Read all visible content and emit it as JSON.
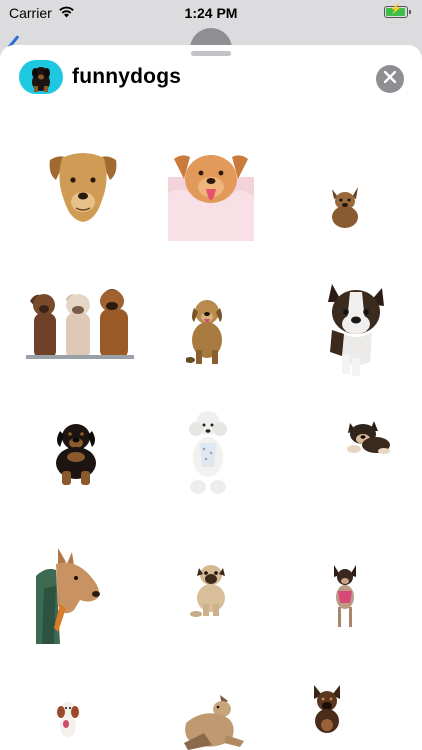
{
  "status_bar": {
    "carrier": "Carrier",
    "time": "1:24 PM",
    "battery_level": 0.85
  },
  "header": {
    "app_name": "funnydogs",
    "app_icon": "rottweiler-puppy-icon",
    "close_icon": "close-icon"
  },
  "colors": {
    "app_icon_background": "#1ec8e0",
    "sheet_background": "#ffffff",
    "close_button": "#8e8e93"
  },
  "stickers": [
    "yellow-lab-head",
    "golden-retriever-feathers",
    "small-brown-dog",
    "three-dogs",
    "sitting-tan-dog",
    "french-bulldog",
    "rottweiler-puppy",
    "white-poodle",
    "lying-puppy",
    "pitbull-with-owner",
    "pug-sitting",
    "chihuahua-standing",
    "small-spaniel",
    "tan-dog-leaping",
    "german-shepherd-puppy"
  ]
}
